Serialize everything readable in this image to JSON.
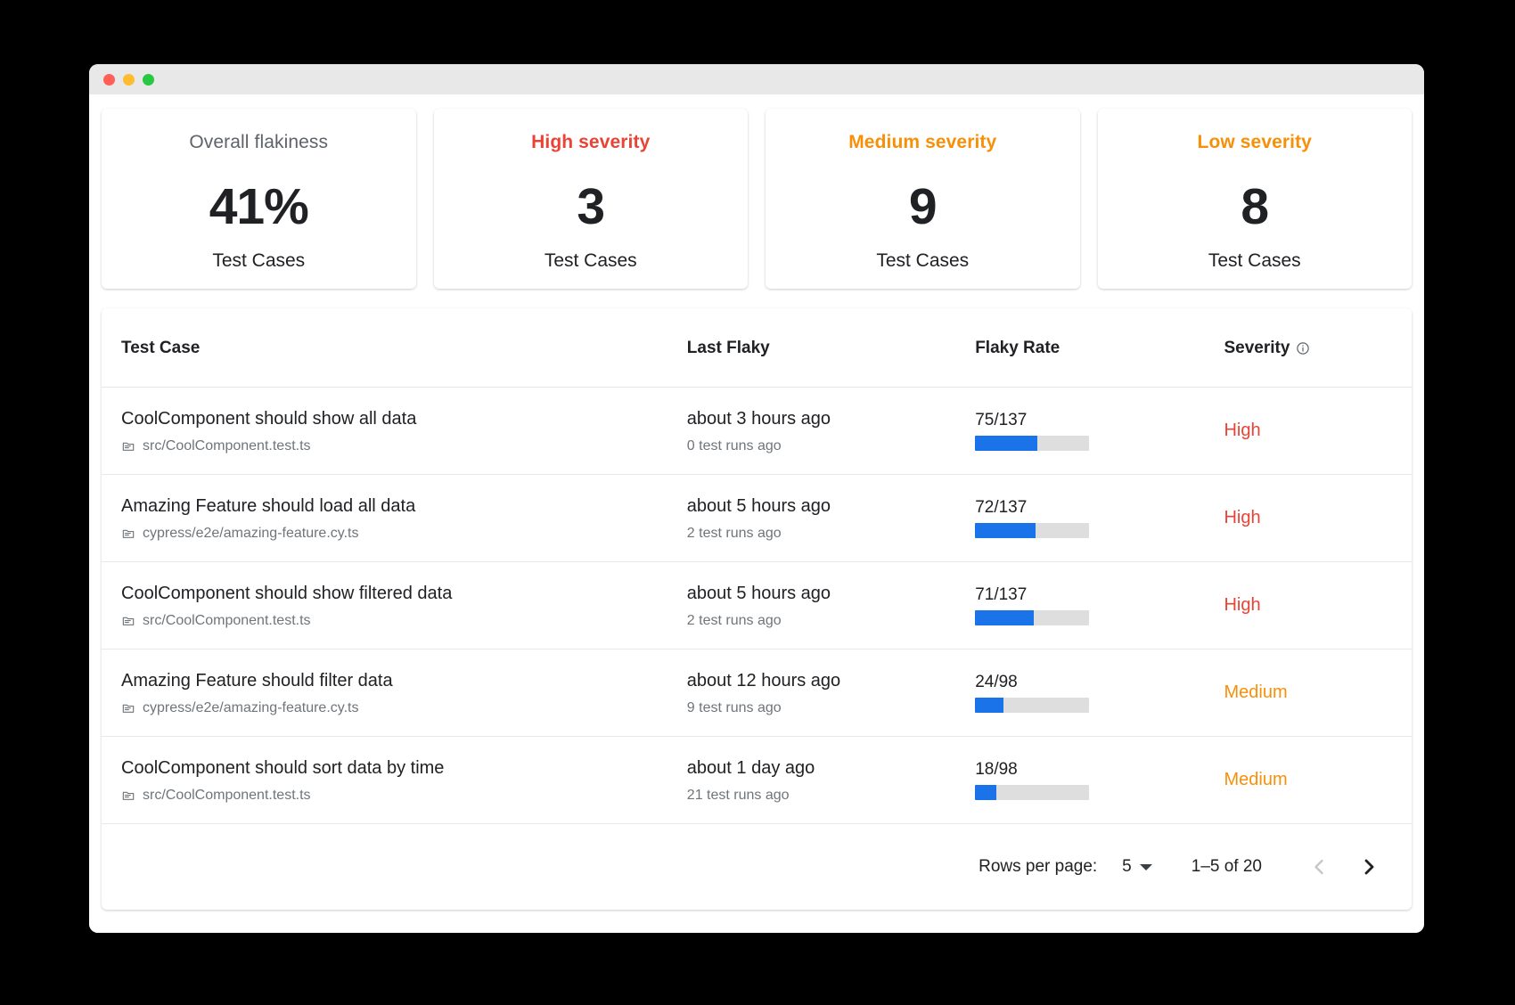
{
  "window": {
    "traffic_lights": [
      "close-red",
      "minimize-yellow",
      "maximize-green"
    ]
  },
  "summary_cards": [
    {
      "title": "Overall flakiness",
      "value": "41%",
      "subtitle": "Test Cases",
      "style": "neutral",
      "color": "#5f6368"
    },
    {
      "title": "High severity",
      "value": "3",
      "subtitle": "Test Cases",
      "style": "sev-high",
      "color": "#ea4335"
    },
    {
      "title": "Medium severity",
      "value": "9",
      "subtitle": "Test Cases",
      "style": "sev-medium",
      "color": "#f79009"
    },
    {
      "title": "Low severity",
      "value": "8",
      "subtitle": "Test Cases",
      "style": "sev-low",
      "color": "#f79009"
    }
  ],
  "table": {
    "headers": {
      "test_case": "Test Case",
      "last_flaky": "Last Flaky",
      "flaky_rate": "Flaky Rate",
      "severity": "Severity",
      "severity_info_icon": "info-icon"
    },
    "rows": [
      {
        "name": "CoolComponent should show all data",
        "file": "src/CoolComponent.test.ts",
        "file_icon": "document-icon",
        "last_flaky": "about 3 hours ago",
        "runs_ago": "0 test runs ago",
        "rate_text": "75/137",
        "rate_numerator": 75,
        "rate_denominator": 137,
        "rate_percent": 54.7,
        "severity": "High"
      },
      {
        "name": "Amazing Feature should load all data",
        "file": "cypress/e2e/amazing-feature.cy.ts",
        "file_icon": "document-icon",
        "last_flaky": "about 5 hours ago",
        "runs_ago": "2 test runs ago",
        "rate_text": "72/137",
        "rate_numerator": 72,
        "rate_denominator": 137,
        "rate_percent": 52.6,
        "severity": "High"
      },
      {
        "name": "CoolComponent should show filtered data",
        "file": "src/CoolComponent.test.ts",
        "file_icon": "document-icon",
        "last_flaky": "about 5 hours ago",
        "runs_ago": "2 test runs ago",
        "rate_text": "71/137",
        "rate_numerator": 71,
        "rate_denominator": 137,
        "rate_percent": 51.8,
        "severity": "High"
      },
      {
        "name": "Amazing Feature should filter data",
        "file": "cypress/e2e/amazing-feature.cy.ts",
        "file_icon": "document-icon",
        "last_flaky": "about 12 hours ago",
        "runs_ago": "9 test runs ago",
        "rate_text": "24/98",
        "rate_numerator": 24,
        "rate_denominator": 98,
        "rate_percent": 24.5,
        "severity": "Medium"
      },
      {
        "name": "CoolComponent should sort data by time",
        "file": "src/CoolComponent.test.ts",
        "file_icon": "document-icon",
        "last_flaky": "about 1 day ago",
        "runs_ago": "21 test runs ago",
        "rate_text": "18/98",
        "rate_numerator": 18,
        "rate_denominator": 98,
        "rate_percent": 18.4,
        "severity": "Medium"
      }
    ]
  },
  "pagination": {
    "rows_per_page_label": "Rows per page:",
    "rows_per_page_value": "5",
    "range_label": "1–5 of 20",
    "prev_icon": "chevron-left-icon",
    "next_icon": "chevron-right-icon",
    "prev_enabled": false,
    "next_enabled": true
  },
  "colors": {
    "progress_fill": "#1a73e8",
    "progress_track": "#dedede",
    "severity_high": "#ea4335",
    "severity_medium": "#f79009",
    "text_primary": "#202124",
    "text_secondary": "#70757a"
  }
}
